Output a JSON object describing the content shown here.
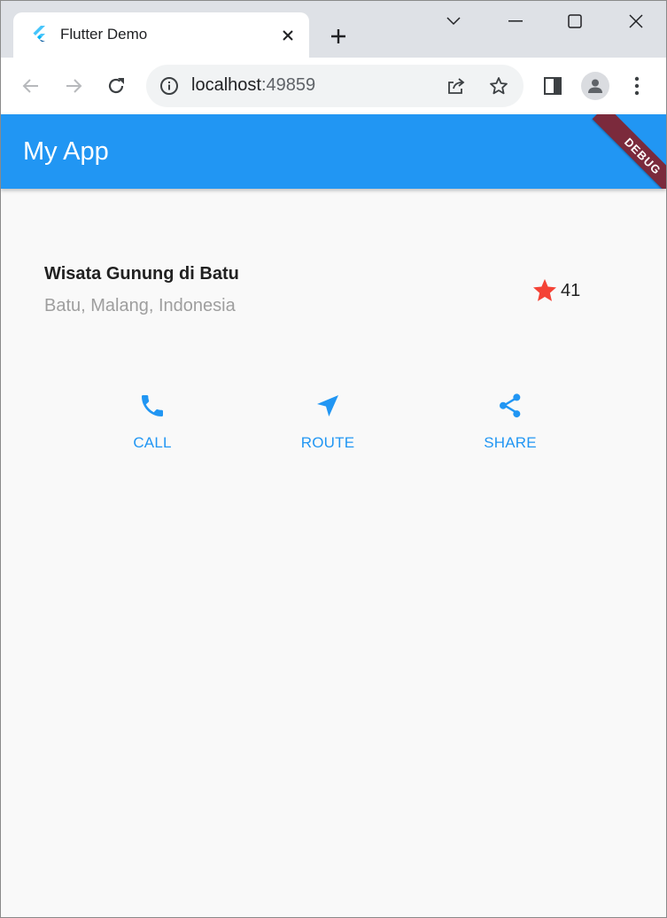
{
  "browser": {
    "tab_title": "Flutter Demo",
    "url_host": "localhost",
    "url_port": ":49859"
  },
  "icons": {
    "tab_favicon": "flutter-logo-icon",
    "tab_close": "close-icon",
    "new_tab": "plus-icon",
    "back": "arrow-left-icon",
    "forward": "arrow-right-icon",
    "reload": "reload-icon",
    "site_info": "info-icon",
    "share_page": "share-page-icon",
    "bookmark": "star-outline-icon",
    "side_panel": "side-panel-icon",
    "profile": "person-icon",
    "menu": "vertical-dots-icon"
  },
  "app": {
    "title": "My App",
    "debug_banner": "DEBUG",
    "accent_color": "#2196f3",
    "place": {
      "name": "Wisata Gunung di Batu",
      "location": "Batu, Malang, Indonesia",
      "rating_count": "41",
      "star_color": "#f44336"
    },
    "actions": [
      {
        "label": "CALL",
        "icon": "phone-icon"
      },
      {
        "label": "ROUTE",
        "icon": "navigation-icon"
      },
      {
        "label": "SHARE",
        "icon": "share-icon"
      }
    ]
  }
}
